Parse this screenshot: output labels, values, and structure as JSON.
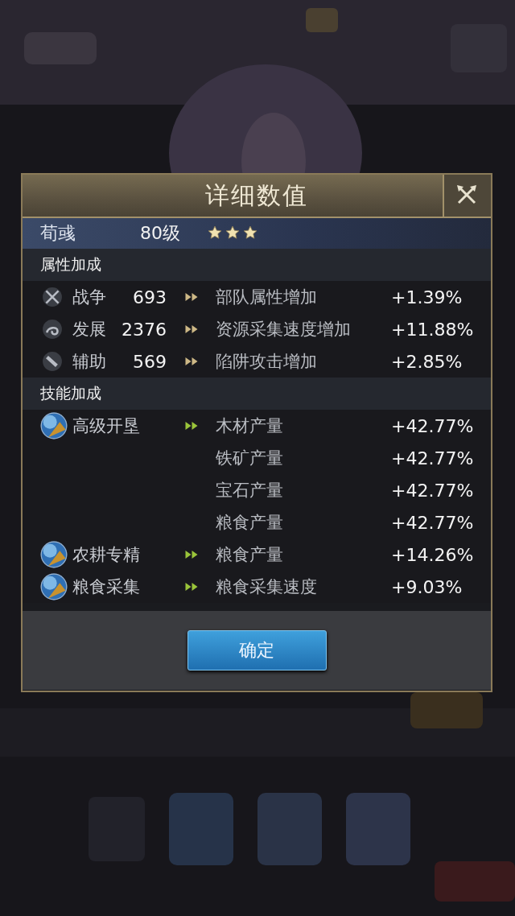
{
  "dialog": {
    "title": "详细数值",
    "hero": {
      "name": "荀彧",
      "level": "80级",
      "stars": 3
    },
    "sections": [
      {
        "title": "属性加成",
        "kind": "attribute",
        "rows": [
          {
            "name": "战争",
            "value": "693",
            "effects": [
              {
                "effect": "部队属性增加",
                "bonus": "+1.39%"
              }
            ]
          },
          {
            "name": "发展",
            "value": "2376",
            "effects": [
              {
                "effect": "资源采集速度增加",
                "bonus": "+11.88%"
              }
            ]
          },
          {
            "name": "辅助",
            "value": "569",
            "effects": [
              {
                "effect": "陷阱攻击增加",
                "bonus": "+2.85%"
              }
            ]
          }
        ]
      },
      {
        "title": "技能加成",
        "kind": "skill",
        "rows": [
          {
            "name": "高级开垦",
            "effects": [
              {
                "effect": "木材产量",
                "bonus": "+42.77%"
              },
              {
                "effect": "铁矿产量",
                "bonus": "+42.77%"
              },
              {
                "effect": "宝石产量",
                "bonus": "+42.77%"
              },
              {
                "effect": "粮食产量",
                "bonus": "+42.77%"
              }
            ]
          },
          {
            "name": "农耕专精",
            "effects": [
              {
                "effect": "粮食产量",
                "bonus": "+14.26%"
              }
            ]
          },
          {
            "name": "粮食采集",
            "effects": [
              {
                "effect": "粮食采集速度",
                "bonus": "+9.03%"
              }
            ]
          }
        ]
      }
    ],
    "confirm_button": "确定"
  }
}
